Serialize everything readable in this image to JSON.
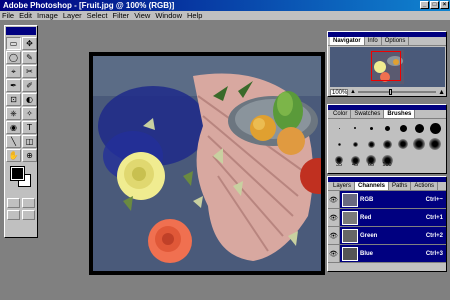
{
  "window": {
    "title": "Adobe Photoshop - [Fruit.jpg @ 100% (RGB)]",
    "controls": [
      "_",
      "□",
      "×"
    ]
  },
  "menu": [
    "File",
    "Edit",
    "Image",
    "Layer",
    "Select",
    "Filter",
    "View",
    "Window",
    "Help"
  ],
  "toolbox": {
    "tools": [
      "▭",
      "✥",
      "◯",
      "✎",
      "⌖",
      "✂",
      "✒",
      "✐",
      "⊡",
      "◐",
      "⎈",
      "✧",
      "◉",
      "T",
      "╲",
      "◫",
      "✋",
      "⊕"
    ],
    "active_index": 0
  },
  "navigator": {
    "tabs": [
      "Navigator",
      "Info",
      "Options"
    ],
    "zoom": "100%",
    "zoom_fraction": 0.4
  },
  "brushes": {
    "tabs": [
      "Color",
      "Swatches",
      "Brushes"
    ],
    "labels": [
      "35",
      "45",
      "65",
      "100"
    ]
  },
  "channels": {
    "tabs": [
      "Layers",
      "Channels",
      "Paths",
      "Actions"
    ],
    "rows": [
      {
        "name": "RGB",
        "key": "Ctrl+~"
      },
      {
        "name": "Red",
        "key": "Ctrl+1"
      },
      {
        "name": "Green",
        "key": "Ctrl+2"
      },
      {
        "name": "Blue",
        "key": "Ctrl+3"
      }
    ]
  },
  "colors": {
    "titlebar": "#000080",
    "selection": "#000080",
    "face": "#c0c0c0",
    "workspace": "#808080"
  }
}
